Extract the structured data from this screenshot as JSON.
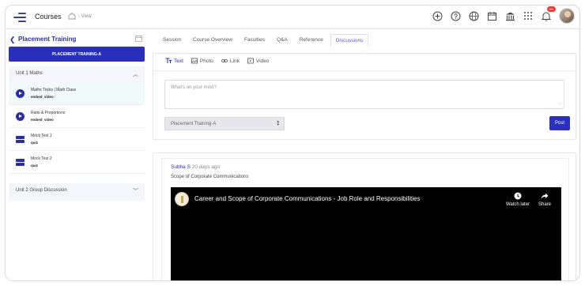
{
  "topbar": {
    "app_title": "Courses",
    "breadcrumb": "- View",
    "notification_count": "99+"
  },
  "sidebar": {
    "course_title": "Placement Training",
    "batch_button": "PLACEMENT TRAINING-A",
    "unit1_label": "Unit 1 Maths",
    "lessons": [
      {
        "name": "Maths Tricks | Math Class",
        "type": "embed_video",
        "kind": "video"
      },
      {
        "name": "Ratio & Proportions",
        "type": "embed_video",
        "kind": "video"
      },
      {
        "name": "Mock Test 1",
        "type": "quiz",
        "kind": "quiz"
      },
      {
        "name": "Mock Test 2",
        "type": "quiz",
        "kind": "quiz"
      }
    ],
    "unit2_label": "Unit 2 Group Discussion"
  },
  "tabs": [
    "Session",
    "Course Overview",
    "Faculties",
    "Q&A",
    "Reference",
    "Discussions"
  ],
  "active_tab": "Discussions",
  "composer": {
    "tabs": [
      "Text",
      "Photo",
      "Link",
      "Video"
    ],
    "placeholder": "What's on your mind?",
    "batch_select": "Placement Training-A",
    "post_label": "Post"
  },
  "post": {
    "author": "Subha S",
    "time_ago": "20 days ago",
    "text": "Scope of Corporate Communications",
    "video_title": "Career and Scope of Corporate Communications - Job Role and Responsibilities",
    "watch_later": "Watch later",
    "share": "Share"
  },
  "colors": {
    "accent": "#2a2fbd",
    "active_tab": "#6a4fc9",
    "badge": "#e53935"
  }
}
